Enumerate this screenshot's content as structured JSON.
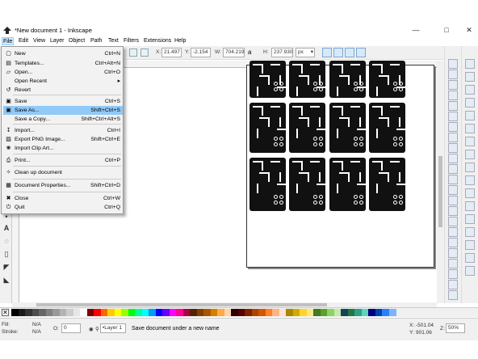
{
  "window": {
    "title": "*New document 1 - Inkscape",
    "minimize": "—",
    "maximize": "□",
    "close": "✕"
  },
  "menubar": [
    "File",
    "Edit",
    "View",
    "Layer",
    "Object",
    "Path",
    "Text",
    "Filters",
    "Extensions",
    "Help"
  ],
  "toolbar": {
    "x_label": "X:",
    "x_value": "21.497",
    "y_label": "Y:",
    "y_value": "-2.154",
    "w_label": "W:",
    "w_value": "704.219",
    "h_label": "H:",
    "h_value": "237.930",
    "unit": "px"
  },
  "file_menu": {
    "items": [
      {
        "icon": "new-icon",
        "glyph": "▢",
        "label": "New",
        "shortcut": "Ctrl+N"
      },
      {
        "icon": "templates-icon",
        "glyph": "▤",
        "label": "Templates...",
        "shortcut": "Ctrl+Alt+N"
      },
      {
        "icon": "open-icon",
        "glyph": "▱",
        "label": "Open...",
        "shortcut": "Ctrl+O"
      },
      {
        "icon": "",
        "glyph": "",
        "label": "Open Recent",
        "shortcut": "▸"
      },
      {
        "icon": "revert-icon",
        "glyph": "↺",
        "label": "Revert",
        "shortcut": ""
      },
      {
        "icon": "save-icon",
        "glyph": "▣",
        "label": "Save",
        "shortcut": "Ctrl+S"
      },
      {
        "icon": "save-as-icon",
        "glyph": "▣",
        "label": "Save As...",
        "shortcut": "Shift+Ctrl+S"
      },
      {
        "icon": "",
        "glyph": "",
        "label": "Save a Copy...",
        "shortcut": "Shift+Ctrl+Alt+S"
      },
      {
        "icon": "import-icon",
        "glyph": "↧",
        "label": "Import...",
        "shortcut": "Ctrl+I"
      },
      {
        "icon": "export-png-icon",
        "glyph": "▨",
        "label": "Export PNG Image...",
        "shortcut": "Shift+Ctrl+E"
      },
      {
        "icon": "clipart-icon",
        "glyph": "❀",
        "label": "Import Clip Art...",
        "shortcut": ""
      },
      {
        "icon": "print-icon",
        "glyph": "⎙",
        "label": "Print...",
        "shortcut": "Ctrl+P"
      },
      {
        "icon": "cleanup-icon",
        "glyph": "✧",
        "label": "Clean up document",
        "shortcut": ""
      },
      {
        "icon": "doc-properties-icon",
        "glyph": "▦",
        "label": "Document Properties...",
        "shortcut": "Shift+Ctrl+D"
      },
      {
        "icon": "close-doc-icon",
        "glyph": "✖",
        "label": "Close",
        "shortcut": "Ctrl+W"
      },
      {
        "icon": "quit-icon",
        "glyph": "⏻",
        "label": "Quit",
        "shortcut": "Ctrl+Q"
      }
    ],
    "highlighted_index": 6
  },
  "status": {
    "fill_label": "Fill:",
    "fill_value": "N/A",
    "stroke_label": "Stroke:",
    "stroke_value": "N/A",
    "opacity_label": "O:",
    "opacity_value": "0",
    "layer": "•Layer 1",
    "message": "Save document under a new name",
    "cursor_x_label": "X:",
    "cursor_x": "-501.04",
    "cursor_y_label": "Y:",
    "cursor_y": "901.06",
    "zoom_label": "Z:",
    "zoom": "50%"
  },
  "colors": {
    "menu_highlight": "#91c9f7",
    "active_menu": "#cde8ff",
    "palette": [
      "#000000",
      "#1a1a1a",
      "#333333",
      "#4d4d4d",
      "#666666",
      "#808080",
      "#999999",
      "#b3b3b3",
      "#cccccc",
      "#e6e6e6",
      "#ffffff",
      "#800000",
      "#ff0000",
      "#ff6600",
      "#ffcc00",
      "#ffff00",
      "#99ff00",
      "#00ff00",
      "#00ff99",
      "#00ffff",
      "#0099ff",
      "#0000ff",
      "#6600ff",
      "#ff00ff",
      "#ff0099",
      "#aa0044",
      "#552200",
      "#804000",
      "#aa5500",
      "#d47f00",
      "#ffaa44",
      "#ffd5aa",
      "#2b0000",
      "#550000",
      "#802000",
      "#aa4400",
      "#d45500",
      "#ff7f2a",
      "#ffb380",
      "#ffe6d5",
      "#aa8800",
      "#d4aa00",
      "#ffd42a",
      "#ffe680",
      "#447821",
      "#5aa02c",
      "#8dd35f",
      "#c6e9af",
      "#164450",
      "#217844",
      "#2ca089",
      "#5fd3bc",
      "#000080",
      "#0044aa",
      "#2a7fff",
      "#80b3ff"
    ]
  }
}
